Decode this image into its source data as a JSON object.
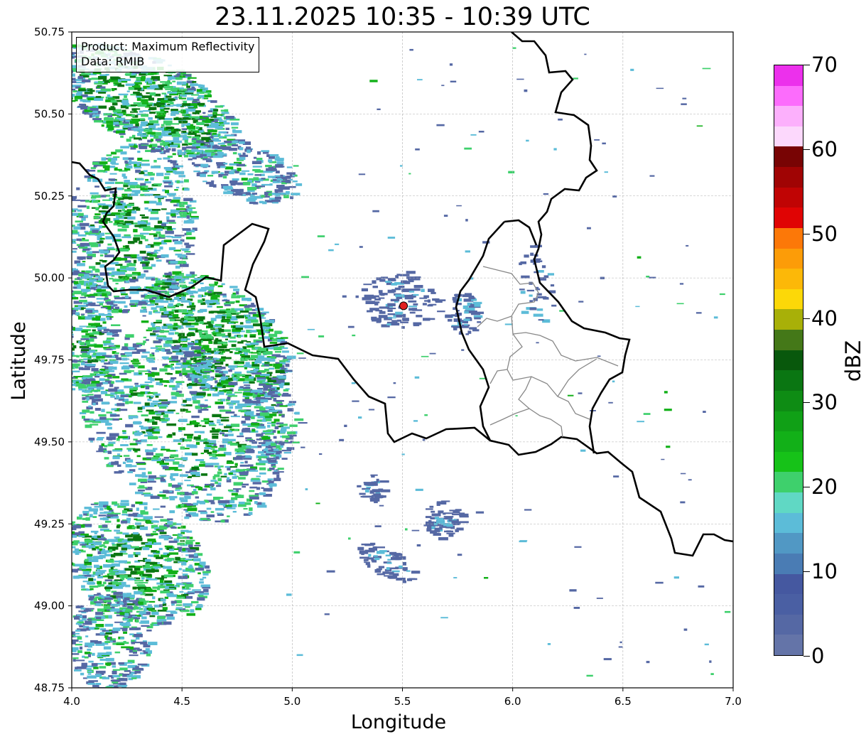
{
  "title": "23.11.2025 10:35 - 10:39 UTC",
  "info": {
    "product": "Product: Maximum Reflectivity",
    "data": "Data: RMIB"
  },
  "axes": {
    "xlabel": "Longitude",
    "ylabel": "Latitude",
    "xlim": [
      4.0,
      7.0
    ],
    "ylim": [
      48.75,
      50.75
    ],
    "xticks": [
      "4.0",
      "4.5",
      "5.0",
      "5.5",
      "6.0",
      "6.5",
      "7.0"
    ],
    "yticks": [
      "48.75",
      "49.00",
      "49.25",
      "49.50",
      "49.75",
      "50.00",
      "50.25",
      "50.50",
      "50.75"
    ],
    "grid": true
  },
  "radar_site": {
    "lon": 5.505,
    "lat": 49.915,
    "color": "#e02020"
  },
  "colorbar": {
    "unit": "dBZ",
    "range": [
      0,
      70
    ],
    "tick_labels": [
      "0",
      "10",
      "20",
      "30",
      "40",
      "50",
      "60",
      "70"
    ],
    "colors": [
      "#6474a8",
      "#5568a4",
      "#4a5fa3",
      "#4558a0",
      "#4a7cb4",
      "#5198c4",
      "#5cbcd8",
      "#60d8c4",
      "#3ed06c",
      "#16c218",
      "#12b018",
      "#10a016",
      "#0e8c14",
      "#0a7612",
      "#08580c",
      "#447818",
      "#a8b008",
      "#fcd808",
      "#fcb808",
      "#fc9c08",
      "#fc7808",
      "#e00404",
      "#c00404",
      "#a00404",
      "#780404",
      "#fcd8fc",
      "#fcb0fc",
      "#fc6cfc",
      "#ec30ec"
    ]
  },
  "legend_colors": {
    "low": "#5568a4",
    "light": "#5cbcd8",
    "mid": "#3ed06c",
    "high": "#12b018",
    "strong": "#0a7612"
  }
}
